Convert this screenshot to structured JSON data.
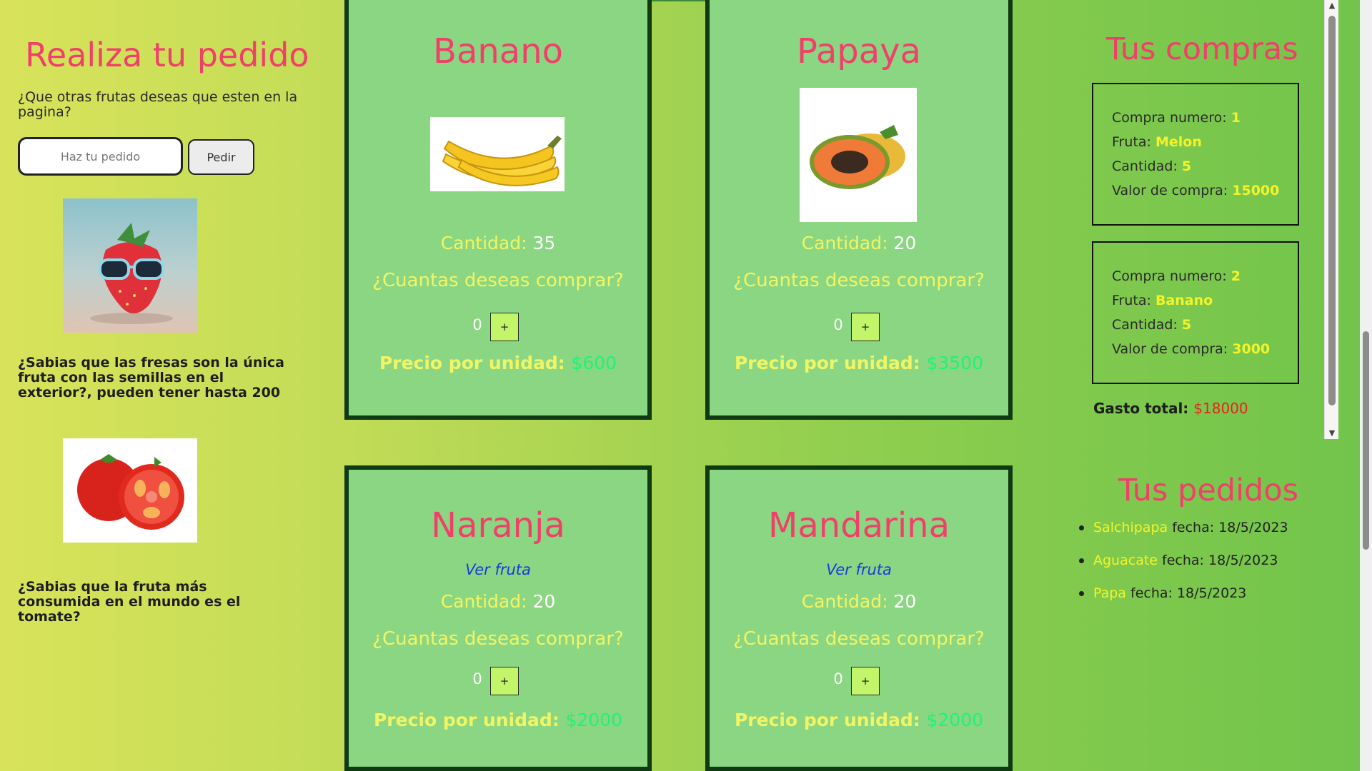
{
  "sidebar": {
    "title": "Realiza tu pedido",
    "question": "¿Que otras frutas deseas que esten en la pagina?",
    "input_placeholder": "Haz tu pedido",
    "button_label": "Pedir",
    "fact1": "¿Sabias que las fresas son la única fruta con las semillas en el exterior?, pueden tener hasta 200",
    "fact2": "¿Sabias que la fruta más consumida en el mundo es el tomate?"
  },
  "labels": {
    "cantidad": "Cantidad:",
    "ask": "¿Cuantas deseas comprar?",
    "price": "Precio por unidad:",
    "ver_fruta": "Ver fruta",
    "plus": "+"
  },
  "products": [
    {
      "name": "Banano",
      "quantity": "35",
      "selected": "0",
      "price": "$600"
    },
    {
      "name": "Papaya",
      "quantity": "20",
      "selected": "0",
      "price": "$3500"
    },
    {
      "name": "Naranja",
      "quantity": "20",
      "selected": "0",
      "price": "$2000"
    },
    {
      "name": "Mandarina",
      "quantity": "20",
      "selected": "0",
      "price": "$2000"
    }
  ],
  "purchases": {
    "title": "Tus compras",
    "labels": {
      "numero": "Compra numero:",
      "fruta": "Fruta:",
      "cantidad": "Cantidad:",
      "valor": "Valor de compra:"
    },
    "items": [
      {
        "numero": "1",
        "fruta": "Melon",
        "cantidad": "5",
        "valor": "15000"
      },
      {
        "numero": "2",
        "fruta": "Banano",
        "cantidad": "5",
        "valor": "3000"
      }
    ],
    "total_label": "Gasto total:",
    "total_value": "$18000"
  },
  "orders": {
    "title": "Tus pedidos",
    "date_label": "fecha:",
    "items": [
      {
        "fruit": "Salchipapa",
        "date": "18/5/2023"
      },
      {
        "fruit": "Aguacate",
        "date": "18/5/2023"
      },
      {
        "fruit": "Papa",
        "date": "18/5/2023"
      }
    ]
  },
  "colors": {
    "heading": "#f0406a",
    "card_bg": "#8bd682",
    "card_border": "#0f3a12",
    "accent_yellow": "#f1f564",
    "price_green": "#1ff27a",
    "total_red": "#e8231c"
  }
}
